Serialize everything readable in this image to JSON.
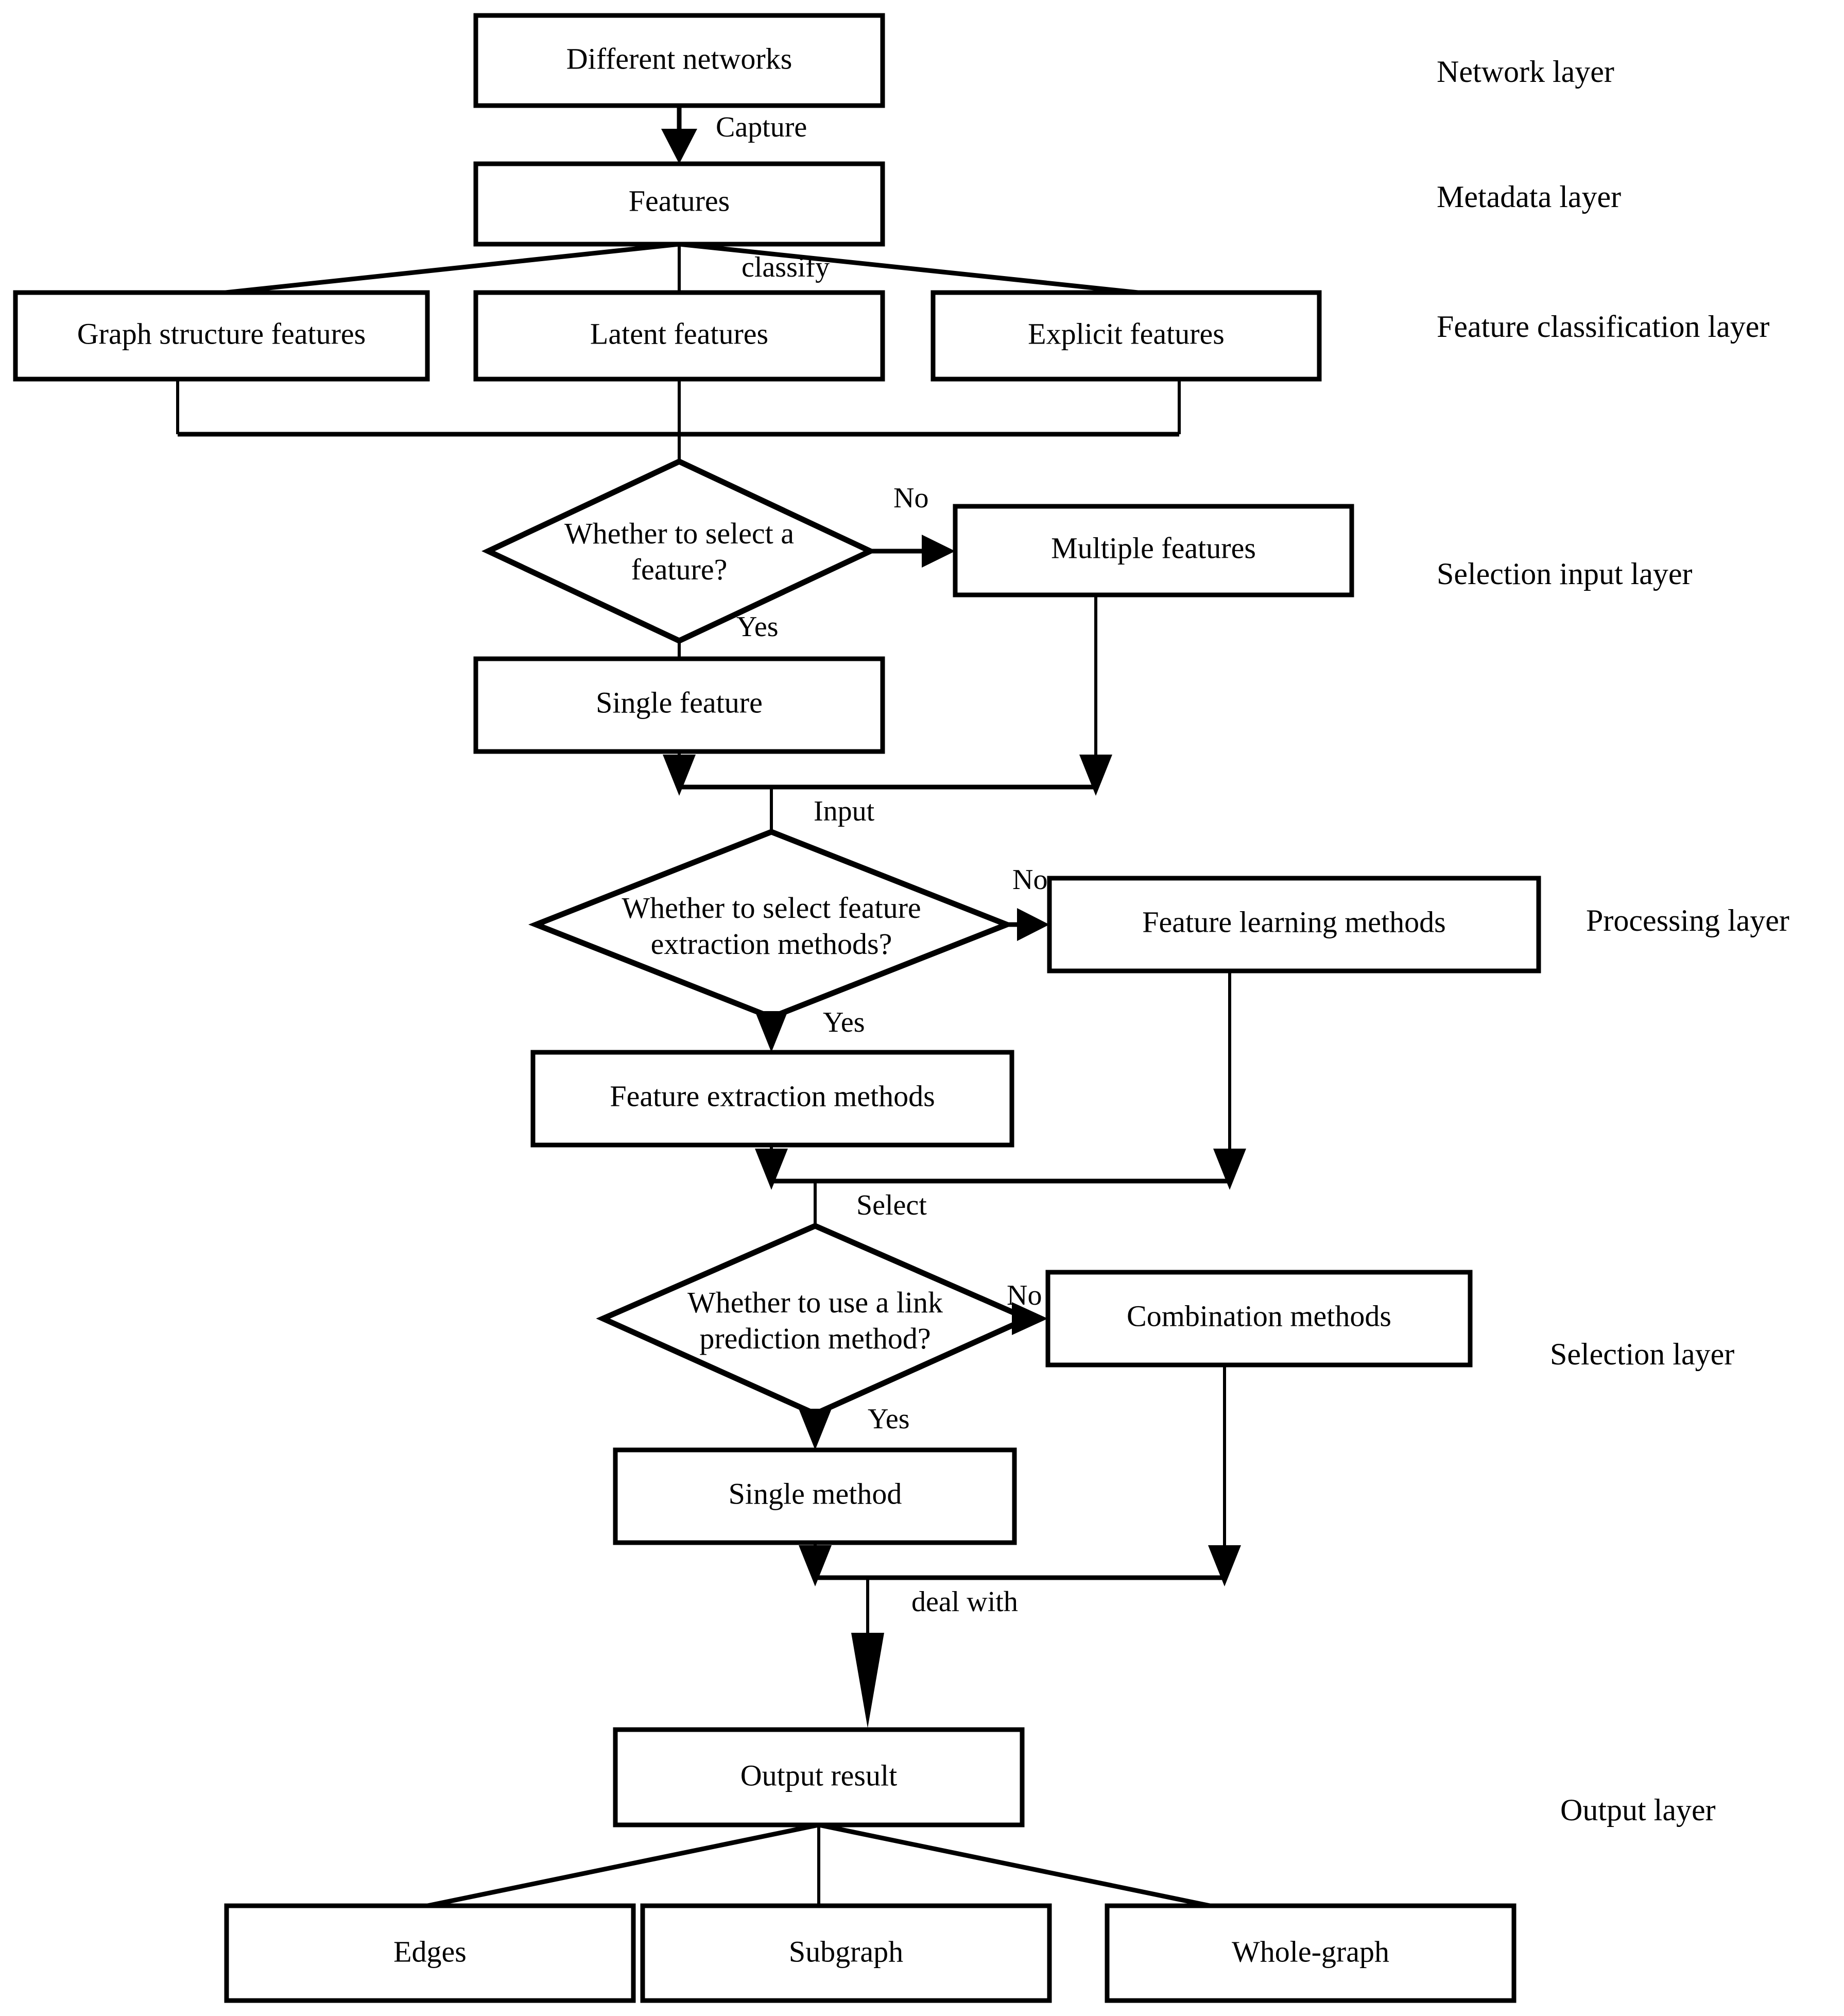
{
  "diagram": {
    "title": "Link prediction feature processing framework flowchart",
    "type": "flowchart",
    "background_color": "#ffffff",
    "line_color": "#000000",
    "text_color": "#000000"
  },
  "nodes": {
    "different_networks": {
      "label": "Different networks",
      "shape": "rect"
    },
    "features": {
      "label": "Features",
      "shape": "rect"
    },
    "graph_structure_features": {
      "label": "Graph structure features",
      "shape": "rect"
    },
    "latent_features": {
      "label": "Latent features",
      "shape": "rect"
    },
    "explicit_features": {
      "label": "Explicit features",
      "shape": "rect"
    },
    "decision_select_feature_line1": {
      "label": "Whether to select a",
      "shape": "diamond"
    },
    "decision_select_feature_line2": {
      "label": "feature?",
      "shape": "diamond"
    },
    "multiple_features": {
      "label": "Multiple features",
      "shape": "rect"
    },
    "single_feature": {
      "label": "Single feature",
      "shape": "rect"
    },
    "decision_extraction_line1": {
      "label": "Whether to select feature",
      "shape": "diamond"
    },
    "decision_extraction_line2": {
      "label": "extraction methods?",
      "shape": "diamond"
    },
    "feature_learning_methods": {
      "label": "Feature learning methods",
      "shape": "rect"
    },
    "feature_extraction_methods": {
      "label": "Feature extraction methods",
      "shape": "rect"
    },
    "decision_link_prediction_line1": {
      "label": "Whether to use a link",
      "shape": "diamond"
    },
    "decision_link_prediction_line2": {
      "label": "prediction method?",
      "shape": "diamond"
    },
    "combination_methods": {
      "label": "Combination methods",
      "shape": "rect"
    },
    "single_method": {
      "label": "Single method",
      "shape": "rect"
    },
    "output_result": {
      "label": "Output result",
      "shape": "rect"
    },
    "edges_node": {
      "label": "Edges",
      "shape": "rect"
    },
    "subgraph_node": {
      "label": "Subgraph",
      "shape": "rect"
    },
    "whole_graph_node": {
      "label": "Whole-graph",
      "shape": "rect"
    }
  },
  "edge_labels": {
    "capture": "Capture",
    "classify": "classify",
    "no_1": "No",
    "yes_1": "Yes",
    "input": "Input",
    "no_2": "No",
    "yes_2": "Yes",
    "select": "Select",
    "no_3": "No",
    "yes_3": "Yes",
    "deal_with": "deal with"
  },
  "layer_labels": {
    "network": "Network layer",
    "metadata": "Metadata layer",
    "feature_classification": "Feature classification layer",
    "selection_input": "Selection input layer",
    "processing": "Processing layer",
    "selection": "Selection layer",
    "output": "Output layer"
  }
}
